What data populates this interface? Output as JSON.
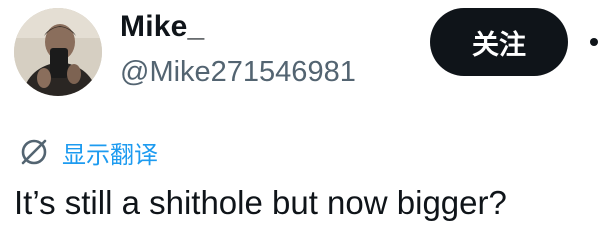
{
  "user": {
    "display_name": "Mike_",
    "handle": "@Mike271546981",
    "avatar": "profile-photo"
  },
  "actions": {
    "follow_label": "关注",
    "more_icon": "more-dots-icon"
  },
  "translate": {
    "label": "显示翻译",
    "icon": "translate-globe-icon"
  },
  "tweet": {
    "text": "It’s still a shithole but now bigger?"
  },
  "colors": {
    "text_primary": "#0f1419",
    "text_secondary": "#536471",
    "link_blue": "#1d9bf0",
    "button_bg": "#0f1419",
    "button_text": "#ffffff"
  }
}
